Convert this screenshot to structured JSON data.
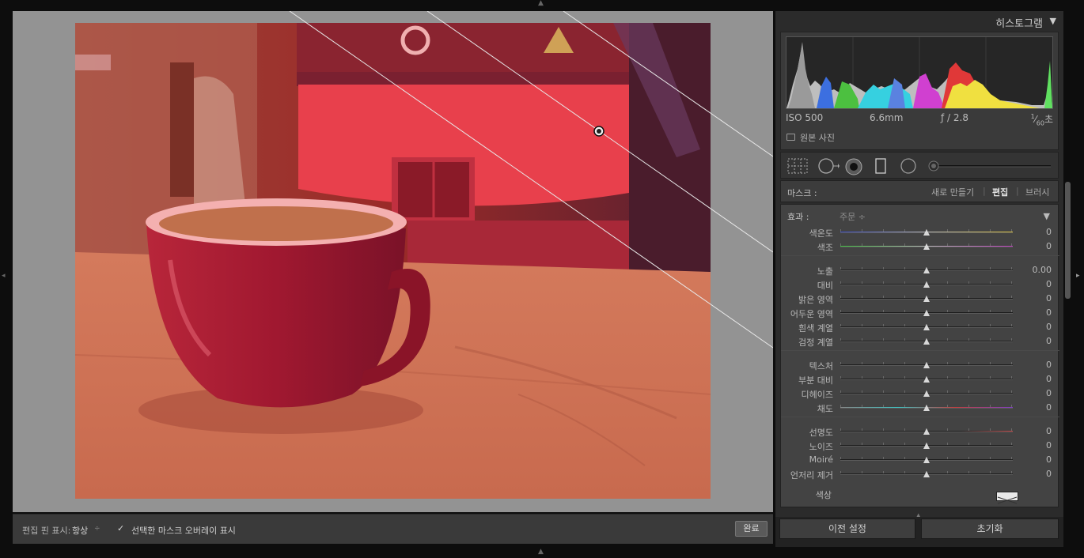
{
  "histogram": {
    "title": "히스토그램",
    "collapse_icon": "triangle-down-icon",
    "info": {
      "iso": "ISO 500",
      "focal_length": "6.6mm",
      "aperture": "ƒ / 2.8",
      "shutter_num": "1",
      "shutter_den": "60",
      "shutter_unit": "초"
    },
    "original_photo_label": "원본 사진"
  },
  "tools": [
    "grid-select-icon",
    "circle-arrow-icon",
    "radial-mask-icon",
    "graduated-filter-icon",
    "circle-icon",
    "tool-size-slider"
  ],
  "mask": {
    "label": "마스크 :",
    "new": "새로 만들기",
    "separator": "|",
    "edit": "편집",
    "brush": "브러시"
  },
  "effects": {
    "label": "효과 :",
    "preset": "주문",
    "preset_arrows": "÷",
    "groups": [
      [
        {
          "label": "색온도",
          "value": "0",
          "track": "temp",
          "level": 0.5
        },
        {
          "label": "색조",
          "value": "0",
          "track": "tint",
          "level": 0.5
        }
      ],
      [
        {
          "label": "노출",
          "value": "0.00",
          "track": "plain",
          "level": 0.5
        },
        {
          "label": "대비",
          "value": "0",
          "track": "plain",
          "level": 0.5
        },
        {
          "label": "밝은 영역",
          "value": "0",
          "track": "plain",
          "level": 0.5
        },
        {
          "label": "어두운 영역",
          "value": "0",
          "track": "plain",
          "level": 0.5
        },
        {
          "label": "흰색 계열",
          "value": "0",
          "track": "plain",
          "level": 0.5
        },
        {
          "label": "검정 계열",
          "value": "0",
          "track": "plain",
          "level": 0.5
        }
      ],
      [
        {
          "label": "텍스처",
          "value": "0",
          "track": "plain",
          "level": 0.5
        },
        {
          "label": "부분 대비",
          "value": "0",
          "track": "plain",
          "level": 0.5
        },
        {
          "label": "디헤이즈",
          "value": "0",
          "track": "plain",
          "level": 0.5
        },
        {
          "label": "채도",
          "value": "0",
          "track": "sat",
          "level": 0.5
        }
      ],
      [
        {
          "label": "선명도",
          "value": "0",
          "track": "sharp",
          "level": 0.5
        },
        {
          "label": "노이즈",
          "value": "0",
          "track": "plain",
          "level": 0.5
        },
        {
          "label": "Moiré",
          "value": "0",
          "track": "plain",
          "level": 0.5
        },
        {
          "label": "언저리 제거",
          "value": "0",
          "track": "plain",
          "level": 0.5
        }
      ]
    ],
    "color_label": "색상"
  },
  "buttons": {
    "previous_settings": "이전 설정",
    "reset": "초기화"
  },
  "toolbar": {
    "pin_label": "편집 핀 표시:",
    "pin_value": "항상",
    "pin_arrows": "÷",
    "overlay_label": "선택한 마스크 오버레이 표시",
    "overlay_checked": true,
    "overlay_check_glyph": "✓",
    "done": "완료"
  },
  "colors": {
    "mask_overlay": "#ff3a3a",
    "panel_bg": "#2b2b2b",
    "canvas_bg": "#939393"
  }
}
